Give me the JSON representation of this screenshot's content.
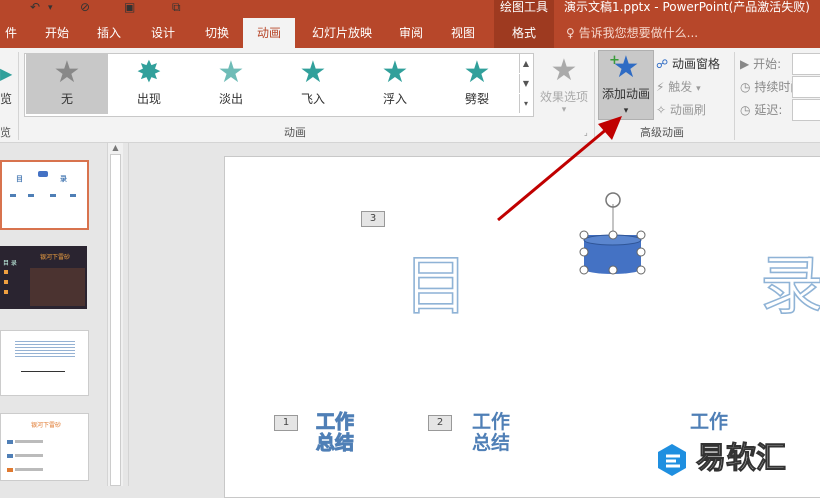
{
  "window": {
    "drawing_tools": "绘图工具",
    "doc_title": "演示文稿1.pptx - PowerPoint(产品激活失败)"
  },
  "tabs": [
    {
      "label": "件"
    },
    {
      "label": "开始"
    },
    {
      "label": "插入"
    },
    {
      "label": "设计"
    },
    {
      "label": "切换"
    },
    {
      "label": "动画"
    },
    {
      "label": "幻灯片放映"
    },
    {
      "label": "审阅"
    },
    {
      "label": "视图"
    },
    {
      "label": "格式"
    }
  ],
  "tell_me": "告诉我您想要做什么...",
  "ribbon": {
    "preview_label": "览",
    "preview_group": "览",
    "gallery": [
      {
        "label": "无",
        "icon": "star-gray-icon"
      },
      {
        "label": "出现",
        "icon": "star-burst-icon"
      },
      {
        "label": "淡出",
        "icon": "star-fade-icon"
      },
      {
        "label": "飞入",
        "icon": "star-fly-icon"
      },
      {
        "label": "浮入",
        "icon": "star-float-icon"
      },
      {
        "label": "劈裂",
        "icon": "star-split-icon"
      }
    ],
    "effect_options": "效果选项",
    "animation_group": "动画",
    "add_animation": "添加动画",
    "animation_pane": "动画窗格",
    "trigger": "触发",
    "animation_painter": "动画刷",
    "advanced_group": "高级动画",
    "start_label": "开始:",
    "duration_label": "持续时间:",
    "delay_label": "延迟:"
  },
  "thumbnails": {
    "slide1": {
      "title_left": "目",
      "title_right": "录"
    },
    "slide2": {
      "title": "银河下雷砂",
      "heading": "目 录"
    },
    "slide4": {
      "title": "银河下雷砂"
    }
  },
  "slide": {
    "tag3": "3",
    "tag1": "1",
    "tag2": "2",
    "char_mu": "目",
    "char_lu": "录",
    "text1_line1": "工作",
    "text1_line2": "总结",
    "text2_line1": "工作",
    "text2_line2": "总结",
    "text3": "工作"
  },
  "watermark": {
    "text": "易软汇"
  },
  "colors": {
    "titlebar": "#b7472a",
    "accent_teal": "#31a09b",
    "shape_fill": "#4472c4",
    "arrow": "#c00000"
  }
}
